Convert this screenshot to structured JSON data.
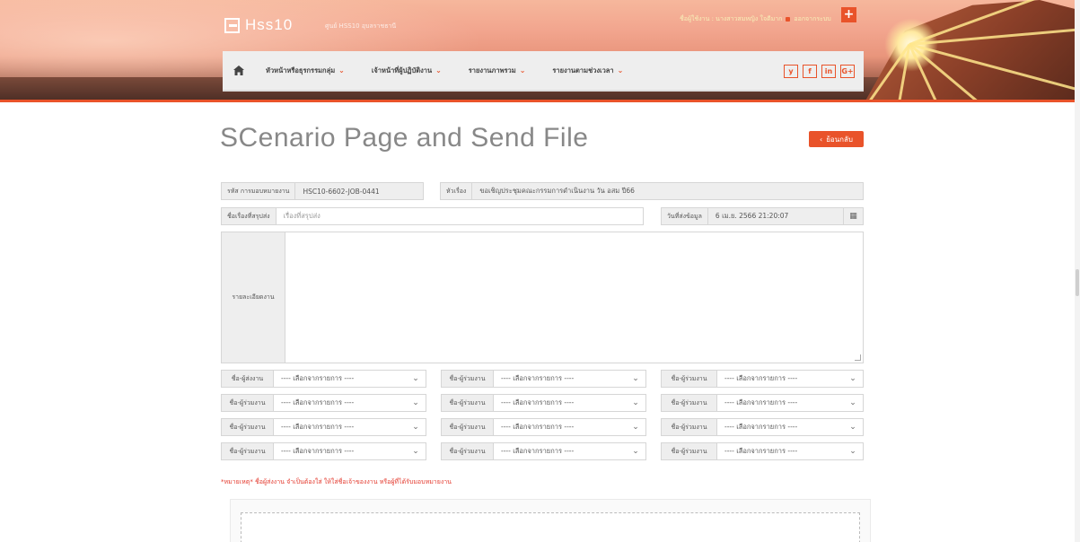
{
  "brand": {
    "logo_text": "Hss10",
    "subtitle": "ศูนย์ HSS10 อุบลราชธานี"
  },
  "user": {
    "greeting": "ชื่อผู้ใช้งาน : นางสาวสมหญิง ใจดีมาก",
    "logout": "ออกจากระบบ"
  },
  "nav": {
    "home_icon": "home-icon",
    "items": [
      {
        "label": "หัวหน้าหรือธุรกรรมกลุ่ม"
      },
      {
        "label": "เจ้าหน้าที่ผู้ปฏิบัติงาน"
      },
      {
        "label": "รายงานภาพรวม"
      },
      {
        "label": "รายงานตามช่วงเวลา"
      }
    ],
    "social": [
      "y",
      "f",
      "in",
      "G+"
    ]
  },
  "page": {
    "title": "SCenario Page and Send File",
    "back_label": "ย้อนกลับ"
  },
  "form": {
    "job_code_label": "รหัส การมอบหมายงาน",
    "job_code_value": "HSC10-6602-JOB-0441",
    "subject_label": "หัวเรื่อง",
    "subject_value": "ขอเชิญประชุมคณะกรรมการดำเนินงาน วัน อสม ปี66",
    "summary_label": "ชื่อเรื่องที่สรุปส่ง",
    "summary_placeholder": "เรื่องที่สรุปส่ง",
    "send_date_label": "วันที่ส่งข้อมูล",
    "send_date_value": "6 เม.ย. 2566 21:20:07",
    "detail_label": "รายละเอียดงาน",
    "select_placeholder": "---- เลือกจากรายการ ----",
    "sender_label": "ชื่อ-ผู้ส่งงาน",
    "coworker_label": "ชื่อ-ผู้ร่วมงาน"
  },
  "note": "*หมายเหตุ* ชื่อผู้ส่งงาน จำเป็นต้องใส่ ให้ใส่ชื่อเจ้าของงาน หรือผู้ที่ได้รับมอบหมายงาน",
  "colors": {
    "accent": "#e9532a",
    "note": "#e43b2f"
  }
}
